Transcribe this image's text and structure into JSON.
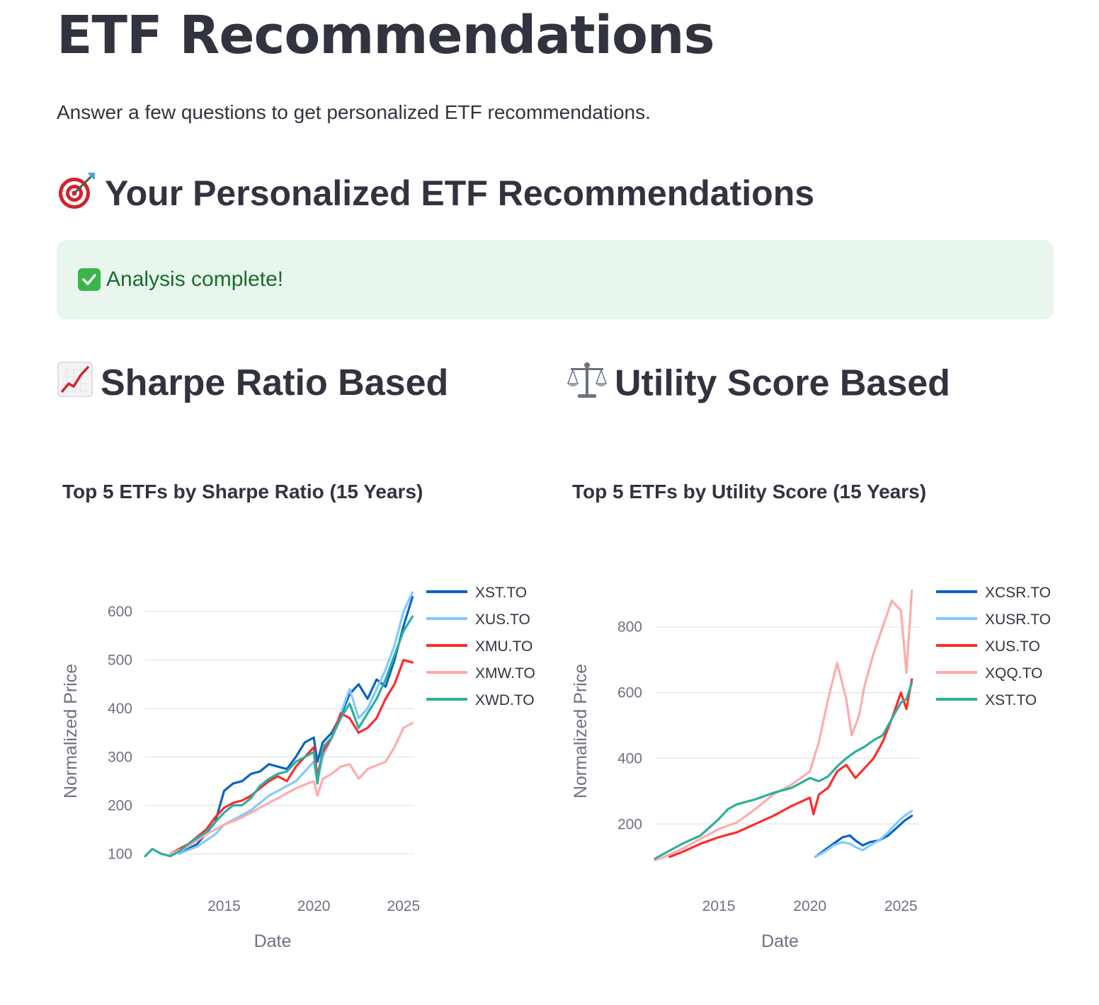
{
  "page": {
    "title": "ETF Recommendations",
    "intro": "Answer a few questions to get personalized ETF recommendations.",
    "section_title": "Your Personalized ETF Recommendations",
    "section_icon": "target-icon",
    "success_message": "Analysis complete!",
    "success_icon": "check-icon",
    "colors": {
      "success_bg": "#e8f6ee",
      "success_text": "#176f2c",
      "text": "#31333f"
    }
  },
  "columns": {
    "left": {
      "title": "Sharpe Ratio Based",
      "icon": "chart-increasing-icon"
    },
    "right": {
      "title": "Utility Score Based",
      "icon": "balance-scale-icon"
    }
  },
  "chart_data": [
    {
      "type": "line",
      "title": "Top 5 ETFs by Sharpe Ratio (15 Years)",
      "xlabel": "Date",
      "ylabel": "Normalized Price",
      "xlim": [
        2010.6,
        2025.6
      ],
      "ylim": [
        80,
        650
      ],
      "xticks": [
        2015,
        2020,
        2025
      ],
      "yticks": [
        100,
        200,
        300,
        400,
        500,
        600
      ],
      "grid": true,
      "legend": "top-right",
      "series": [
        {
          "name": "XST.TO",
          "color": "#0a63c3",
          "x": [
            2012.5,
            2013.5,
            2014.5,
            2015.0,
            2015.5,
            2016.0,
            2016.5,
            2017.0,
            2017.5,
            2018.0,
            2018.5,
            2019.0,
            2019.5,
            2020.0,
            2020.2,
            2020.5,
            2021.0,
            2021.5,
            2022.0,
            2022.5,
            2023.0,
            2023.5,
            2024.0,
            2024.5,
            2025.0,
            2025.5
          ],
          "y": [
            100,
            120,
            165,
            230,
            245,
            250,
            265,
            270,
            285,
            280,
            275,
            300,
            330,
            340,
            290,
            330,
            350,
            385,
            430,
            450,
            420,
            460,
            445,
            500,
            570,
            630
          ]
        },
        {
          "name": "XUS.TO",
          "color": "#83c9ff",
          "x": [
            2012.5,
            2013.5,
            2014.5,
            2015.0,
            2015.5,
            2016.0,
            2016.5,
            2017.0,
            2017.5,
            2018.0,
            2018.5,
            2019.0,
            2019.5,
            2020.0,
            2020.2,
            2020.5,
            2021.0,
            2021.5,
            2022.0,
            2022.5,
            2023.0,
            2023.5,
            2024.0,
            2024.5,
            2025.0,
            2025.5
          ],
          "y": [
            100,
            115,
            140,
            160,
            170,
            180,
            190,
            205,
            220,
            230,
            240,
            250,
            270,
            290,
            250,
            300,
            340,
            390,
            440,
            380,
            400,
            440,
            480,
            530,
            600,
            640
          ]
        },
        {
          "name": "XMU.TO",
          "color": "#ff2b2b",
          "x": [
            2012.0,
            2013.0,
            2014.0,
            2014.5,
            2015.0,
            2015.5,
            2016.0,
            2016.5,
            2017.0,
            2017.5,
            2018.0,
            2018.5,
            2019.0,
            2019.5,
            2020.0,
            2020.2,
            2020.5,
            2021.0,
            2021.5,
            2022.0,
            2022.5,
            2023.0,
            2023.5,
            2024.0,
            2024.5,
            2025.0,
            2025.5
          ],
          "y": [
            100,
            120,
            150,
            175,
            195,
            205,
            210,
            220,
            235,
            250,
            260,
            250,
            280,
            300,
            320,
            260,
            310,
            340,
            390,
            380,
            350,
            360,
            380,
            420,
            450,
            500,
            495
          ]
        },
        {
          "name": "XMW.TO",
          "color": "#ffabab",
          "x": [
            2012.0,
            2013.0,
            2014.0,
            2015.0,
            2016.0,
            2017.0,
            2018.0,
            2019.0,
            2020.0,
            2020.2,
            2020.5,
            2021.0,
            2021.5,
            2022.0,
            2022.5,
            2023.0,
            2024.0,
            2024.5,
            2025.0,
            2025.5
          ],
          "y": [
            100,
            115,
            140,
            160,
            175,
            195,
            215,
            235,
            250,
            220,
            255,
            265,
            280,
            285,
            255,
            275,
            290,
            320,
            360,
            370
          ]
        },
        {
          "name": "XWD.TO",
          "color": "#29b09d",
          "x": [
            2010.6,
            2011.0,
            2011.5,
            2012.0,
            2012.5,
            2013.0,
            2014.0,
            2015.0,
            2015.5,
            2016.0,
            2016.5,
            2017.0,
            2017.5,
            2018.0,
            2018.5,
            2019.0,
            2019.5,
            2020.0,
            2020.2,
            2020.5,
            2021.0,
            2021.5,
            2022.0,
            2022.5,
            2023.0,
            2023.5,
            2024.0,
            2024.5,
            2025.0,
            2025.5
          ],
          "y": [
            95,
            110,
            100,
            95,
            105,
            120,
            145,
            185,
            200,
            200,
            215,
            240,
            255,
            265,
            270,
            290,
            300,
            310,
            245,
            320,
            340,
            380,
            410,
            360,
            390,
            420,
            460,
            510,
            560,
            590
          ]
        }
      ]
    },
    {
      "type": "line",
      "title": "Top 5 ETFs by Utility Score (15 Years)",
      "xlabel": "Date",
      "ylabel": "Normalized Price",
      "xlim": [
        2011.5,
        2026.0
      ],
      "ylim": [
        80,
        920
      ],
      "xticks": [
        2015,
        2020,
        2025
      ],
      "yticks": [
        200,
        400,
        600,
        800
      ],
      "grid": true,
      "legend": "top-right",
      "series": [
        {
          "name": "XCSR.TO",
          "color": "#0a63c3",
          "x": [
            2020.3,
            2020.8,
            2021.3,
            2021.8,
            2022.2,
            2022.5,
            2022.9,
            2023.3,
            2023.8,
            2024.3,
            2024.8,
            2025.2,
            2025.6
          ],
          "y": [
            100,
            120,
            140,
            160,
            165,
            150,
            135,
            145,
            150,
            165,
            190,
            210,
            225
          ]
        },
        {
          "name": "XUSR.TO",
          "color": "#83c9ff",
          "x": [
            2020.3,
            2020.8,
            2021.3,
            2021.8,
            2022.2,
            2022.5,
            2022.9,
            2023.3,
            2023.8,
            2024.3,
            2024.8,
            2025.2,
            2025.6
          ],
          "y": [
            100,
            115,
            135,
            145,
            140,
            130,
            120,
            135,
            150,
            175,
            205,
            225,
            240
          ]
        },
        {
          "name": "XUS.TO",
          "color": "#ff2b2b",
          "x": [
            2012.3,
            2013.0,
            2014.0,
            2015.0,
            2016.0,
            2017.0,
            2018.0,
            2019.0,
            2020.0,
            2020.2,
            2020.5,
            2021.0,
            2021.5,
            2022.0,
            2022.5,
            2023.0,
            2023.5,
            2024.0,
            2024.5,
            2025.0,
            2025.3,
            2025.6
          ],
          "y": [
            100,
            115,
            140,
            160,
            175,
            200,
            225,
            255,
            280,
            230,
            290,
            310,
            360,
            380,
            340,
            370,
            400,
            450,
            520,
            600,
            550,
            640
          ]
        },
        {
          "name": "XQQ.TO",
          "color": "#ffabab",
          "x": [
            2011.5,
            2012.0,
            2013.0,
            2014.0,
            2015.0,
            2016.0,
            2017.0,
            2018.0,
            2019.0,
            2020.0,
            2020.5,
            2021.0,
            2021.5,
            2022.0,
            2022.3,
            2022.7,
            2023.0,
            2023.5,
            2024.0,
            2024.5,
            2025.0,
            2025.3,
            2025.6
          ],
          "y": [
            90,
            100,
            125,
            155,
            185,
            205,
            245,
            290,
            320,
            360,
            450,
            580,
            690,
            580,
            470,
            530,
            620,
            720,
            800,
            880,
            850,
            660,
            910
          ]
        },
        {
          "name": "XST.TO",
          "color": "#29b09d",
          "x": [
            2011.5,
            2012.0,
            2013.0,
            2014.0,
            2015.0,
            2015.5,
            2016.0,
            2017.0,
            2018.0,
            2019.0,
            2019.5,
            2020.0,
            2020.5,
            2021.0,
            2021.5,
            2022.0,
            2022.5,
            2023.0,
            2023.5,
            2024.0,
            2024.5,
            2025.0,
            2025.3,
            2025.6
          ],
          "y": [
            95,
            110,
            140,
            165,
            215,
            245,
            260,
            275,
            295,
            310,
            325,
            340,
            330,
            345,
            375,
            400,
            420,
            435,
            455,
            470,
            520,
            570,
            580,
            630
          ]
        }
      ]
    }
  ]
}
